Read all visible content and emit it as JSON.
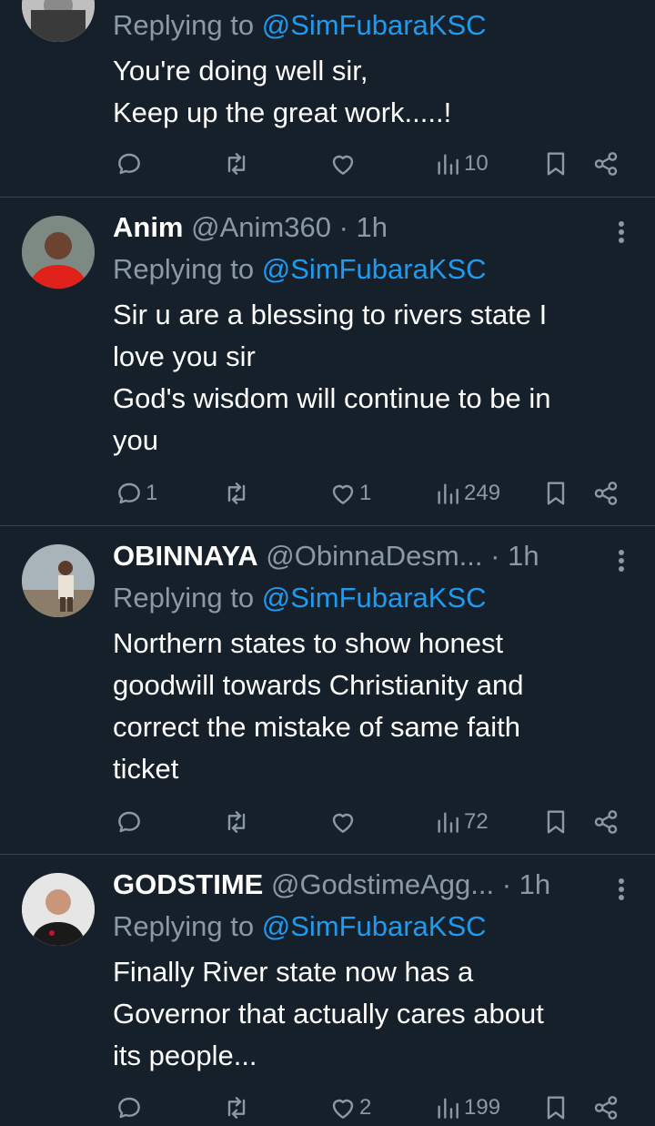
{
  "tweets": [
    {
      "name": "",
      "handle": "",
      "time": "",
      "replying_prefix": "Replying to",
      "replying_to": "@SimFubaraKSC",
      "lines": [
        "You're doing well sir,",
        "Keep up the great work.....!"
      ],
      "replies": "",
      "retweets": "",
      "likes": "",
      "views": "10"
    },
    {
      "name": "Anim",
      "handle": "@Anim360",
      "time": "· 1h",
      "replying_prefix": "Replying to",
      "replying_to": "@SimFubaraKSC",
      "lines": [
        "Sir u are a blessing to rivers state I",
        "love you sir",
        "God's wisdom will continue to be in",
        "you"
      ],
      "replies": "1",
      "retweets": "",
      "likes": "1",
      "views": "249"
    },
    {
      "name": "OBINNAYA",
      "handle": "@ObinnaDesm...",
      "time": "· 1h",
      "replying_prefix": "Replying to",
      "replying_to": "@SimFubaraKSC",
      "lines": [
        "Northern states to show honest",
        "goodwill towards Christianity and",
        "correct the mistake of same faith",
        "ticket"
      ],
      "replies": "",
      "retweets": "",
      "likes": "",
      "views": "72"
    },
    {
      "name": "GODSTIME",
      "handle": "@GodstimeAgg...",
      "time": "· 1h",
      "replying_prefix": "Replying to",
      "replying_to": "@SimFubaraKSC",
      "lines": [
        "Finally River state now has a",
        "Governor that actually cares about",
        "its people..."
      ],
      "replies": "",
      "retweets": "",
      "likes": "2",
      "views": "199"
    }
  ],
  "colors": {
    "background": "#15202b",
    "muted": "#8b98a5",
    "accent": "#1d9bf0",
    "divider": "#38444d"
  },
  "icons": [
    "reply-icon",
    "retweet-icon",
    "like-icon",
    "views-icon",
    "bookmark-icon",
    "share-icon",
    "more-icon"
  ]
}
